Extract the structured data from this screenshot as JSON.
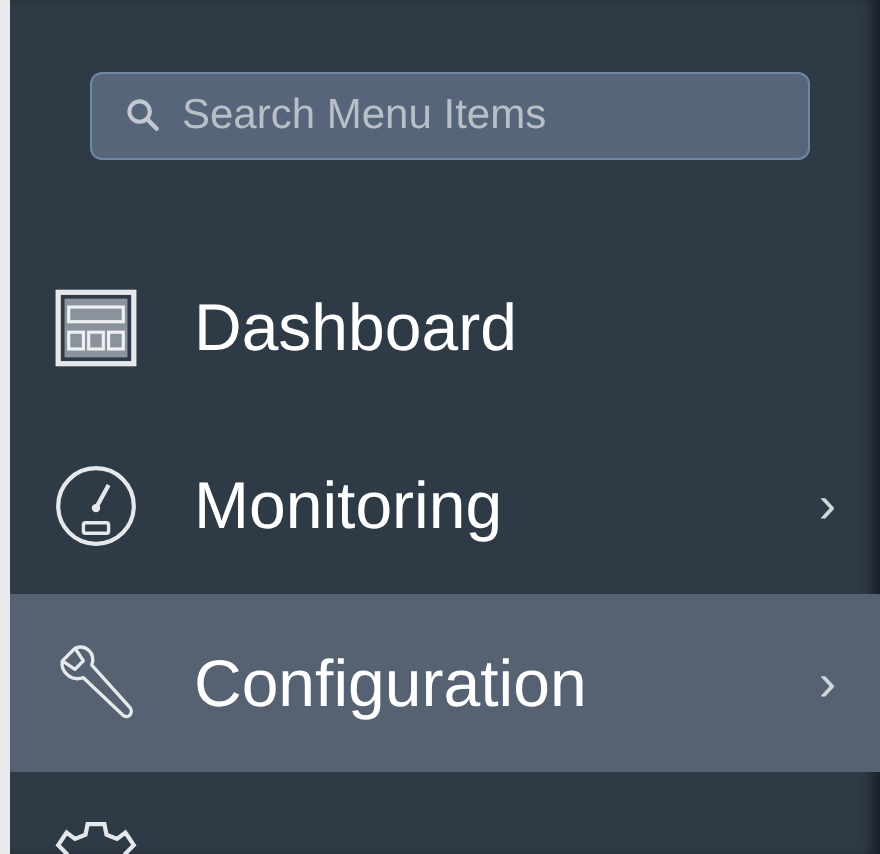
{
  "search": {
    "placeholder": "Search Menu Items"
  },
  "menu": [
    {
      "kind": "dashboard",
      "label": "Dashboard",
      "selected": false
    },
    {
      "kind": "monitoring",
      "label": "Monitoring",
      "selected": false,
      "arrow": "›"
    },
    {
      "kind": "configuration",
      "label": "Configuration",
      "selected": true,
      "arrow": "›"
    },
    {
      "kind": "administration",
      "selected": false
    }
  ]
}
